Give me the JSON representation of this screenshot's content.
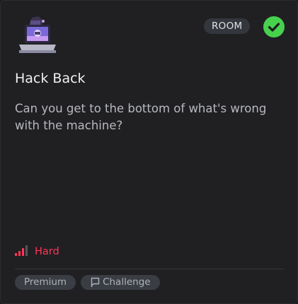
{
  "card": {
    "type_badge": "ROOM",
    "completed_icon": "checkmark-icon",
    "room_icon": "laptop-hacker-icon",
    "title": "Hack Back",
    "description": "Can you get to the bottom of what's wrong with the machine?",
    "difficulty": {
      "icon": "signal-bars-icon",
      "label": "Hard",
      "bars_filled": 3,
      "bars_total": 4
    },
    "tags": [
      {
        "label": "Premium"
      },
      {
        "label": "Challenge",
        "icon": "flag-icon"
      }
    ]
  },
  "colors": {
    "card_background": "#202023",
    "completed_green": "#47d14d",
    "difficulty_hard": "#ff3556",
    "tag_background": "#3a3d44"
  }
}
